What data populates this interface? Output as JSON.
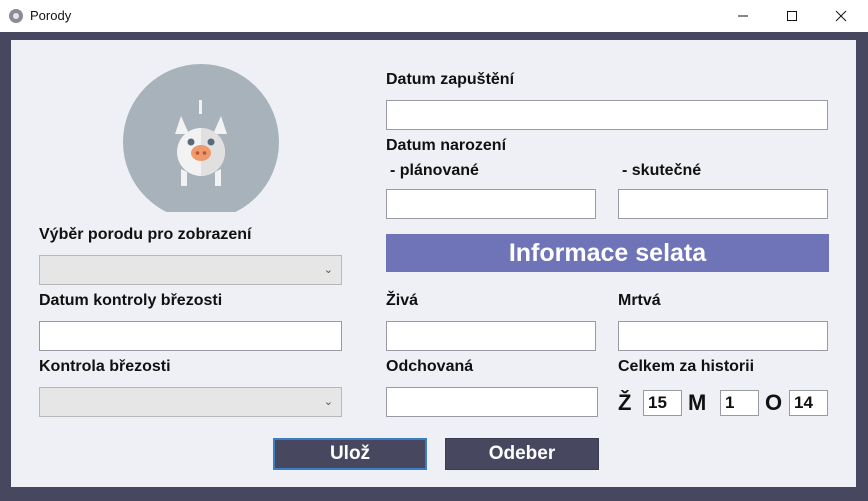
{
  "window": {
    "title": "Porody"
  },
  "left": {
    "birth_select_label": "Výběr porodu pro zobrazení",
    "pregnancy_check_date_label": "Datum kontroly březosti",
    "pregnancy_check_label": "Kontrola březosti"
  },
  "right": {
    "insemination_date_label": "Datum zapuštění",
    "birth_date_label": "Datum narození",
    "planned_label": "- plánované",
    "actual_label": "- skutečné",
    "piglet_info_banner": "Informace selata",
    "alive_label": "Živá",
    "dead_label": "Mrtvá",
    "weaned_label": "Odchovaná",
    "history_total_label": "Celkem za historii"
  },
  "history": {
    "alive_letter": "Ž",
    "alive_value": "15",
    "dead_letter": "M",
    "dead_value": "1",
    "weaned_letter": "O",
    "weaned_value": "14"
  },
  "buttons": {
    "save": "Ulož",
    "remove": "Odeber"
  },
  "icons": {
    "app": "app-icon",
    "logo": "pig-icon"
  },
  "colors": {
    "frame": "#474760",
    "banner": "#6f73b8",
    "logo_circle": "#a7b2bb",
    "pig": "#f2f2f2",
    "snout": "#f0996b"
  }
}
